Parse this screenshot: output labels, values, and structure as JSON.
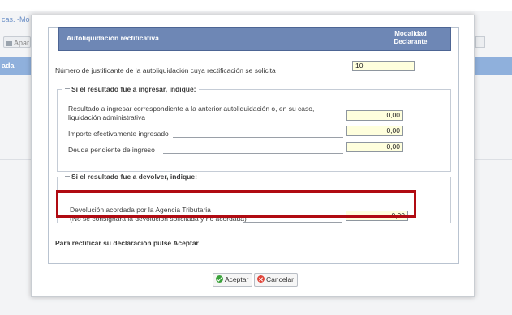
{
  "background": {
    "top_link": "cas. -Mo",
    "toolbar_button": "Apar",
    "bar_label": "ada"
  },
  "modal": {
    "title": "Autoliquidación rectificativa",
    "modalidad_line1": "Modalidad",
    "modalidad_line2": "Declarante",
    "justificante": {
      "label": "Número de justificante de la autoliquidación cuya rectificación se solicita",
      "value": "10"
    },
    "ingresar": {
      "legend": "Si el resultado fue a ingresar, indique:",
      "fields": [
        {
          "label": "Resultado a ingresar correspondiente a la anterior autoliquidación o, en su caso,",
          "label2": "liquidación administrativa",
          "value": "0,00"
        },
        {
          "label": "Importe efectivamente ingresado",
          "value": "0,00"
        },
        {
          "label": "Deuda pendiente de ingreso",
          "value": "0,00"
        }
      ]
    },
    "devolver": {
      "legend": "Si el resultado fue a devolver, indique:",
      "field": {
        "label": "Devolución acordada por la Agencia Tributaria",
        "label2": "(No se consignará la devolución solicitada y no acordada)",
        "value": "0,00"
      }
    },
    "footer_note": "Para rectificar su declaración pulse Aceptar",
    "buttons": {
      "accept": "Aceptar",
      "cancel": "Cancelar"
    }
  }
}
